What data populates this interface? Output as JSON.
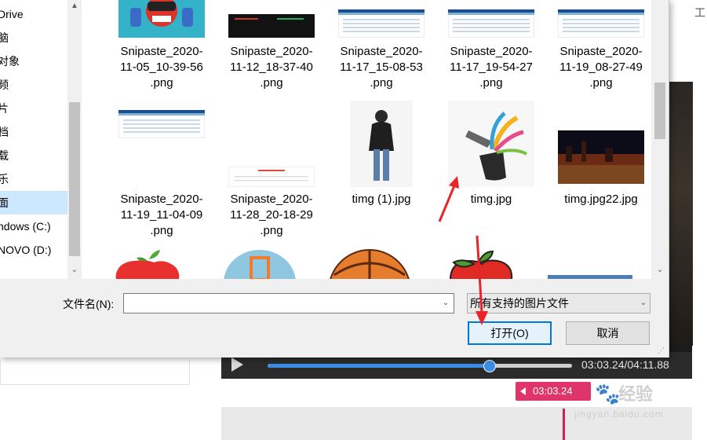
{
  "background": {
    "top_glyph": "工",
    "player": {
      "progress": 0.727,
      "time_text": "03:03.24/04:11.88",
      "time_tag": "03:03.24",
      "accent": "#3a8ee6",
      "tag_color": "#e0356a"
    },
    "watermark": {
      "text": "经验",
      "domain": "jingyan.baidu.com"
    }
  },
  "dialog": {
    "nav_items": [
      {
        "label": "Drive",
        "selected": false
      },
      {
        "label": "脑",
        "selected": false
      },
      {
        "label": "对象",
        "selected": false
      },
      {
        "label": "频",
        "selected": false
      },
      {
        "label": "片",
        "selected": false
      },
      {
        "label": "档",
        "selected": false
      },
      {
        "label": "载",
        "selected": false
      },
      {
        "label": "乐",
        "selected": false
      },
      {
        "label": "面",
        "selected": true
      },
      {
        "label": "ndows (C:)",
        "selected": false
      },
      {
        "label": "NOVO (D:)",
        "selected": false
      }
    ],
    "files": [
      {
        "name": "Snipaste_2020-11-05_10-39-56.png",
        "thumb": "robot"
      },
      {
        "name": "Snipaste_2020-11-12_18-37-40.png",
        "thumb": "dark"
      },
      {
        "name": "Snipaste_2020-11-17_15-08-53.png",
        "thumb": "page"
      },
      {
        "name": "Snipaste_2020-11-17_19-54-27.png",
        "thumb": "page"
      },
      {
        "name": "Snipaste_2020-11-19_08-27-49.png",
        "thumb": "page"
      },
      {
        "name": "Snipaste_2020-11-19_11-04-09.png",
        "thumb": "page"
      },
      {
        "name": "Snipaste_2020-11-28_20-18-29.png",
        "thumb": "redpage"
      },
      {
        "name": "timg (1).jpg",
        "thumb": "man"
      },
      {
        "name": "timg.jpg",
        "thumb": "magic-hat"
      },
      {
        "name": "timg.jpg22.jpg",
        "thumb": "city"
      }
    ],
    "filename_label": "文件名(N):",
    "filename_value": "",
    "file_type": "所有支持的图片文件",
    "open_button": "打开(O)",
    "cancel_button": "取消"
  },
  "annotations": {
    "arrow_color": "#e8232a"
  }
}
